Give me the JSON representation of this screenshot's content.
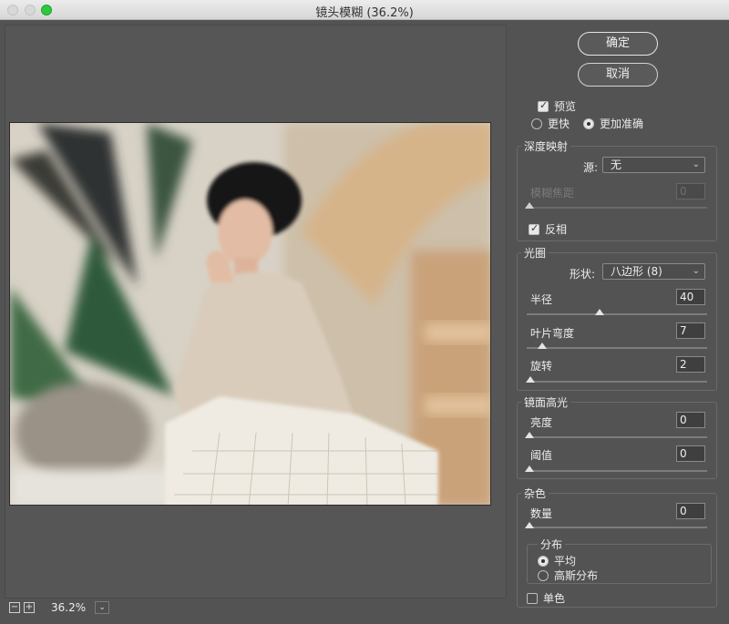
{
  "window": {
    "title": "镜头模糊 (36.2%)"
  },
  "zoom": {
    "minus": "−",
    "plus": "+",
    "value": "36.2%",
    "dropdown": "⌄"
  },
  "buttons": {
    "ok": "确定",
    "cancel": "取消"
  },
  "preview": {
    "checkbox_label": "预览",
    "checked": true,
    "modes": [
      {
        "label": "更快",
        "selected": false
      },
      {
        "label": "更加准确",
        "selected": true
      }
    ]
  },
  "depth_map": {
    "title": "深度映射",
    "source_label": "源:",
    "source_value": "无",
    "focal_label": "模糊焦距",
    "focal_value": "0",
    "invert_label": "反相",
    "invert_checked": true
  },
  "iris": {
    "title": "光圈",
    "shape_label": "形状:",
    "shape_value": "八边形 (8)",
    "radius_label": "半径",
    "radius_value": "40",
    "radius_level": 0.4,
    "curvature_label": "叶片弯度",
    "curvature_value": "7",
    "curvature_level": 0.07,
    "rotation_label": "旋转",
    "rotation_value": "2",
    "rotation_level": 0.01
  },
  "specular": {
    "title": "镜面高光",
    "brightness_label": "亮度",
    "brightness_value": "0",
    "threshold_label": "阈值",
    "threshold_value": "0"
  },
  "noise": {
    "title": "杂色",
    "amount_label": "数量",
    "amount_value": "0",
    "distribution_title": "分布",
    "distributions": [
      {
        "label": "平均",
        "selected": true
      },
      {
        "label": "高斯分布",
        "selected": false
      }
    ],
    "mono_label": "单色",
    "mono_checked": false
  }
}
